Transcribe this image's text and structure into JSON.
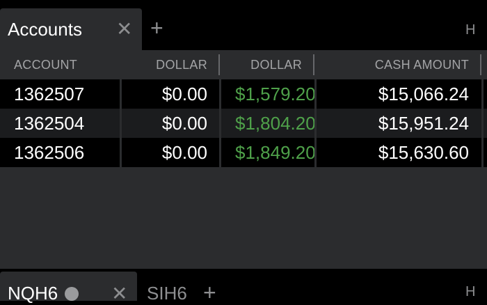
{
  "top_tabs": {
    "active": {
      "label": "Accounts",
      "close": "✕"
    },
    "add": "+",
    "edge": "H"
  },
  "table": {
    "headers": [
      "ACCOUNT",
      "DOLLAR",
      "DOLLAR",
      "CASH AMOUNT"
    ],
    "rows": [
      {
        "account": "1362507",
        "dollar1": "$0.00",
        "dollar2": "$1,579.20",
        "cash": "$15,066.24"
      },
      {
        "account": "1362504",
        "dollar1": "$0.00",
        "dollar2": "$1,804.20",
        "cash": "$15,951.24"
      },
      {
        "account": "1362506",
        "dollar1": "$0.00",
        "dollar2": "$1,849.20",
        "cash": "$15,630.60"
      }
    ],
    "positive_color": "#4fa14a"
  },
  "bottom_tabs": {
    "active": {
      "label": "NQH6",
      "close": "✕"
    },
    "second": "SIH6",
    "add": "+",
    "edge": "H"
  }
}
